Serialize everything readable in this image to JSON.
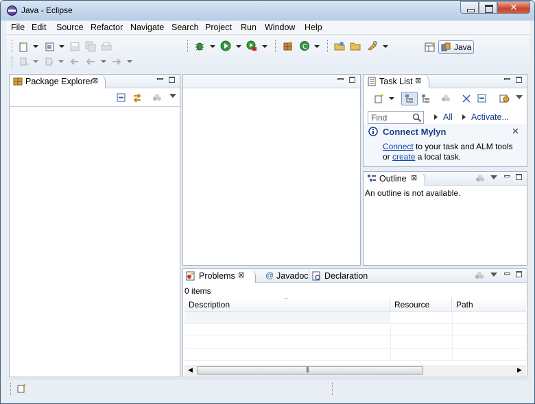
{
  "window": {
    "title": "Java - Eclipse",
    "close_glyph": "✕"
  },
  "menu": [
    "File",
    "Edit",
    "Source",
    "Refactor",
    "Navigate",
    "Search",
    "Project",
    "Run",
    "Window",
    "Help"
  ],
  "perspective": {
    "label": "Java"
  },
  "package_explorer": {
    "tab_label": "Package Explorer"
  },
  "task_list": {
    "tab_label": "Task List",
    "find_placeholder": "Find",
    "all_label": "All",
    "activate_label": "Activate...",
    "connect_title": "Connect Mylyn",
    "connect_link": "Connect",
    "connect_text": " to your task and ALM tools",
    "or_text": "or ",
    "create_link": "create",
    "create_text": " a local task."
  },
  "outline": {
    "tab_label": "Outline",
    "message": "An outline is not available."
  },
  "problems": {
    "tabs": [
      "Problems",
      "Javadoc",
      "Declaration"
    ],
    "count": "0 items",
    "columns": [
      "Description",
      "Resource",
      "Path"
    ]
  },
  "colors": {
    "accent": "#1b3f8b",
    "link": "#0645ad",
    "chrome": "#e9eef5"
  }
}
